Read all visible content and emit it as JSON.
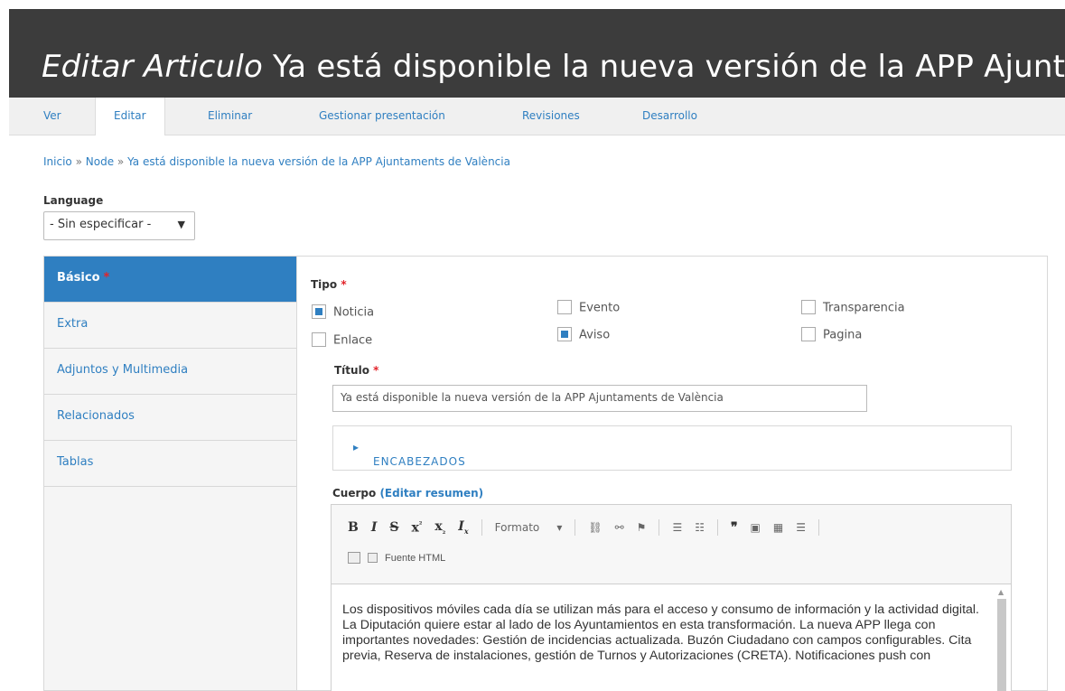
{
  "page": {
    "title_prefix": "Editar Articulo",
    "title_rest": "Ya está disponible la nueva versión de la APP Ajuntamen"
  },
  "tabs": [
    "Ver",
    "Editar",
    "Eliminar",
    "Gestionar presentación",
    "Revisiones",
    "Desarrollo"
  ],
  "breadcrumb": {
    "items": [
      "Inicio",
      "Node",
      "Ya está disponible la nueva versión de la APP Ajuntaments de València"
    ],
    "separator": "»"
  },
  "language": {
    "label": "Language",
    "selected": "- Sin especificar -"
  },
  "vertical_tabs": [
    "Básico",
    "Extra",
    "Adjuntos y Multimedia",
    "Relacionados",
    "Tablas"
  ],
  "tipo": {
    "label": "Tipo",
    "options": [
      {
        "label": "Noticia",
        "checked": true
      },
      {
        "label": "Evento",
        "checked": false
      },
      {
        "label": "Transparencia",
        "checked": false
      },
      {
        "label": "Enlace",
        "checked": false
      },
      {
        "label": "Aviso",
        "checked": true
      },
      {
        "label": "Pagina",
        "checked": false
      }
    ]
  },
  "titulo": {
    "label": "Título",
    "value": "Ya está disponible la nueva versión de la APP Ajuntaments de València"
  },
  "encabezados": "ENCABEZADOS",
  "cuerpo": {
    "label": "Cuerpo",
    "edit_summary": "(Editar resumen)",
    "toolbar_format": "Formato",
    "source_html": "Fuente HTML",
    "text": "Los dispositivos móviles cada día se utilizan más para el acceso y consumo de información y la actividad digital. La Diputación quiere estar al lado de los Ayuntamientos en esta transformación. La nueva APP llega con importantes novedades: Gestión de incidencias actualizada. Buzón Ciudadano con campos configurables. Cita previa, Reserva de instalaciones, gestión de Turnos y Autorizaciones (CRETA). Notificaciones push con"
  },
  "required_mark": "*"
}
